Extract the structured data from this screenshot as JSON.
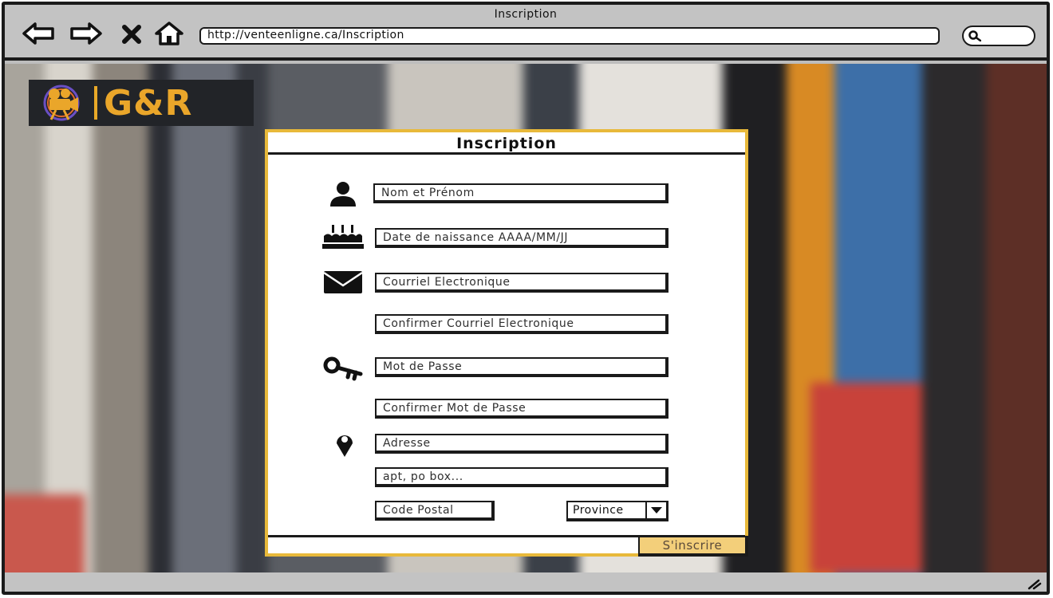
{
  "window": {
    "title": "Inscription"
  },
  "browser": {
    "url": "http://venteenligne.ca/Inscription",
    "nav_icons": [
      "back-arrow-icon",
      "forward-arrow-icon",
      "close-icon",
      "home-icon"
    ]
  },
  "logo": {
    "text": "G&R",
    "icon": "film-camera-icon",
    "color": "#eaa62a"
  },
  "form": {
    "title": "Inscription",
    "fields": {
      "name": {
        "placeholder": "Nom et Prénom",
        "icon": "user-icon"
      },
      "birthdate": {
        "placeholder": "Date de naissance AAAA/MM/JJ",
        "icon": "birthday-cake-icon"
      },
      "email": {
        "placeholder": "Courriel Electronique",
        "icon": "envelope-icon"
      },
      "email_confirm": {
        "placeholder": "Confirmer Courriel Electronique"
      },
      "password": {
        "placeholder": "Mot de Passe",
        "icon": "key-icon"
      },
      "password_confirm": {
        "placeholder": "Confirmer Mot de Passe"
      },
      "address": {
        "placeholder": "Adresse",
        "icon": "map-pin-icon"
      },
      "address2": {
        "placeholder": "apt, po box..."
      },
      "postal_code": {
        "placeholder": "Code Postal"
      }
    },
    "province": {
      "selected": "Province"
    },
    "submit_label": "S'inscrire",
    "accent_color": "#e8b93a",
    "button_color": "#f3cf7a"
  }
}
